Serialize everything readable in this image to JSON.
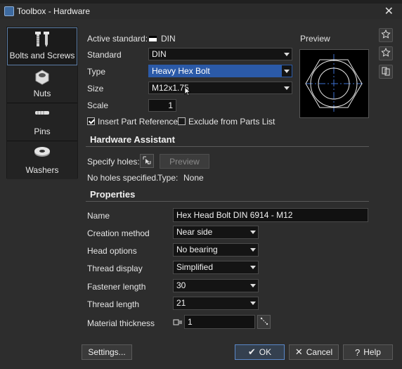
{
  "window": {
    "title": "Toolbox - Hardware",
    "close_glyph": "✕"
  },
  "categories": [
    {
      "label": "Bolts and Screws",
      "icon": "bolts-icon",
      "active": true
    },
    {
      "label": "Nuts",
      "icon": "nut-icon",
      "active": false
    },
    {
      "label": "Pins",
      "icon": "pin-icon",
      "active": false
    },
    {
      "label": "Washers",
      "icon": "washer-icon",
      "active": false
    }
  ],
  "standard_section": {
    "active_standard_label": "Active standard:",
    "active_standard_value": "DIN",
    "standard_label": "Standard",
    "standard_value": "DIN",
    "type_label": "Type",
    "type_value": "Heavy Hex Bolt",
    "size_label": "Size",
    "size_value": "M12x1.75",
    "scale_label": "Scale",
    "scale_value": "1",
    "insert_ref_label": "Insert Part Reference",
    "insert_ref_checked": true,
    "exclude_label": "Exclude from Parts List",
    "exclude_checked": false
  },
  "preview": {
    "label": "Preview"
  },
  "assistant": {
    "title": "Hardware Assistant",
    "specify_label": "Specify holes:",
    "preview_button": "Preview",
    "status_text": "No holes specified.",
    "type_label": "Type:",
    "type_value": "None"
  },
  "properties": {
    "title": "Properties",
    "name_label": "Name",
    "name_value": "Hex Head Bolt DIN 6914 - M12",
    "creation_label": "Creation method",
    "creation_value": "Near side",
    "head_label": "Head options",
    "head_value": "No bearing",
    "thread_display_label": "Thread display",
    "thread_display_value": "Simplified",
    "fastener_label": "Fastener length",
    "fastener_value": "30",
    "thread_length_label": "Thread length",
    "thread_length_value": "21",
    "material_label": "Material thickness",
    "material_value": "1"
  },
  "footer": {
    "settings": "Settings...",
    "ok": "OK",
    "ok_glyph": "✔",
    "cancel": "Cancel",
    "cancel_glyph": "✕",
    "help": "Help",
    "help_glyph": "?"
  }
}
